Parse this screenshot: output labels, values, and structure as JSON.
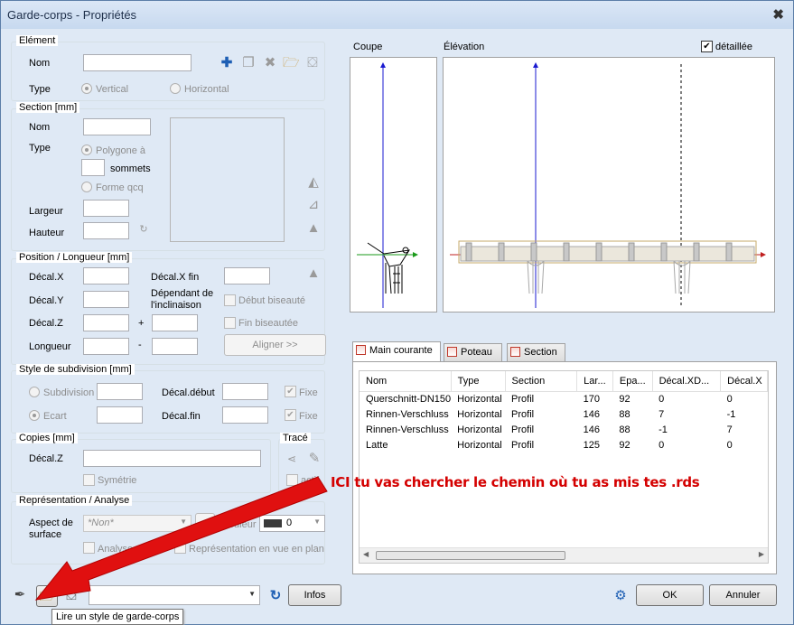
{
  "window": {
    "title": "Garde-corps - Propriétés",
    "close": "✖"
  },
  "element": {
    "legend": "Elément",
    "nom_label": "Nom",
    "nom_value": "",
    "type_label": "Type",
    "type_vertical": "Vertical",
    "type_horizontal": "Horizontal"
  },
  "section": {
    "legend": "Section  [mm]",
    "nom_label": "Nom",
    "type_label": "Type",
    "polygone": "Polygone à",
    "sommets": "sommets",
    "forme": "Forme qcq",
    "largeur": "Largeur",
    "hauteur": "Hauteur"
  },
  "position": {
    "legend": "Position / Longueur [mm]",
    "decal_x": "Décal.X",
    "decal_y": "Décal.Y",
    "decal_z": "Décal.Z",
    "longueur": "Longueur",
    "decal_x_fin": "Décal.X fin",
    "dependant": "Dépendant de",
    "inclinaison": "l'inclinaison",
    "debut_biseaute": "Début biseauté",
    "fin_biseautee": "Fin biseautée",
    "plus": "+",
    "minus": "-",
    "aligner": "Aligner >>"
  },
  "subdivision": {
    "legend": "Style de subdivision [mm]",
    "subdivision": "Subdivision",
    "ecart": "Ecart",
    "decal_debut": "Décal.début",
    "decal_fin": "Décal.fin",
    "fixe1": "Fixe",
    "fixe2": "Fixe"
  },
  "copies": {
    "legend": "Copies  [mm]",
    "decal_z": "Décal.Z",
    "symetrie": "Symétrie"
  },
  "trace": {
    "legend": "Tracé",
    "actif": "actif"
  },
  "representation": {
    "legend": "Représentation / Analyse",
    "aspect1": "Aspect de",
    "aspect2": "surface",
    "aspect_value": "*Non*",
    "couleur": "Couleur",
    "couleur_value": "0",
    "analyse": "Analyse",
    "rep_plan": "Représentation en vue en plan"
  },
  "preview": {
    "coupe": "Coupe",
    "elevation": "Élévation",
    "detaillee": "détaillée",
    "detaillee_checked": true
  },
  "tabs": [
    {
      "label": "Main courante"
    },
    {
      "label": "Poteau"
    },
    {
      "label": "Section"
    }
  ],
  "table": {
    "headers": [
      "Nom",
      "Type",
      "Section",
      "Lar...",
      "Epa...",
      "Décal.XD...",
      "Décal.X"
    ],
    "rows": [
      [
        "Querschnitt-DN150",
        "Horizontal",
        "Profil",
        "170",
        "92",
        "0",
        "0"
      ],
      [
        "Rinnen-Verschluss",
        "Horizontal",
        "Profil",
        "146",
        "88",
        "7",
        "-1"
      ],
      [
        "Rinnen-Verschluss",
        "Horizontal",
        "Profil",
        "146",
        "88",
        "-1",
        "7"
      ],
      [
        "Latte",
        "Horizontal",
        "Profil",
        "125",
        "92",
        "0",
        "0"
      ]
    ]
  },
  "bottom": {
    "combo_value": "",
    "infos": "Infos",
    "ok": "OK",
    "annuler": "Annuler",
    "tooltip": "Lire un style de garde-corps"
  },
  "annotation": {
    "text": "ICI tu vas chercher le chemin où tu as mis tes .rds",
    "color": "#d40000"
  },
  "icons": {
    "add": "plus-icon",
    "copy": "copy-icon",
    "delete": "delete-icon",
    "open": "folder-open-icon",
    "save": "save-icon"
  }
}
